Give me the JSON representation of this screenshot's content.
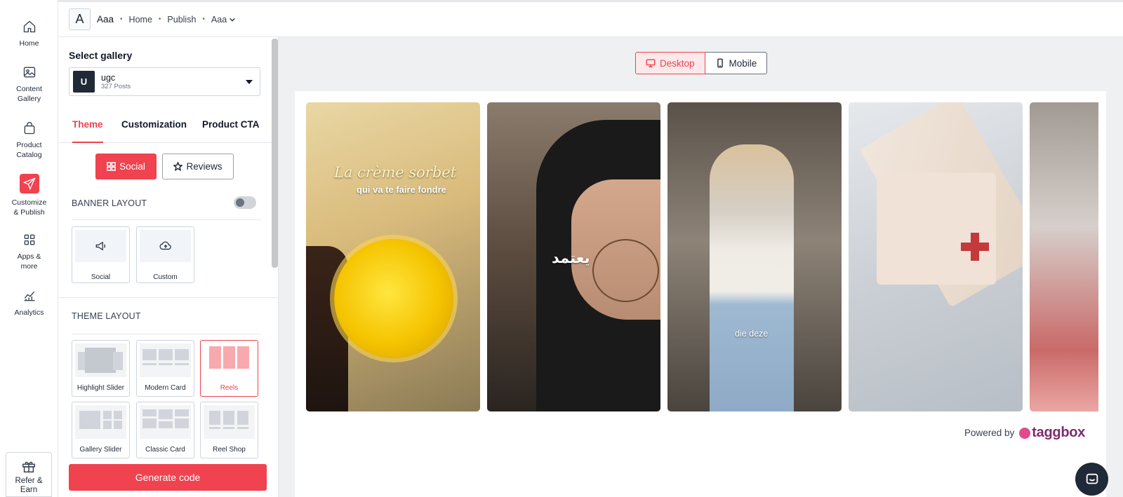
{
  "nav": {
    "items": [
      {
        "label_1": "Home",
        "label_2": "",
        "icon": "home-icon"
      },
      {
        "label_1": "Content",
        "label_2": "Gallery",
        "icon": "image-icon"
      },
      {
        "label_1": "Product",
        "label_2": "Catalog",
        "icon": "shopping-bag-icon"
      },
      {
        "label_1": "Customize",
        "label_2": "& Publish",
        "icon": "paper-plane-icon"
      },
      {
        "label_1": "Apps &",
        "label_2": "more",
        "icon": "grid-icon"
      },
      {
        "label_1": "Analytics",
        "label_2": "",
        "icon": "chart-icon"
      }
    ],
    "refer": {
      "label_1": "Refer &",
      "label_2": "Earn",
      "icon": "gift-icon"
    }
  },
  "header": {
    "logo_letter": "A",
    "workspace": "Aaa",
    "sep": "•",
    "crumbs": [
      "Home",
      "Publish"
    ],
    "dropdown": "Aaa"
  },
  "panel": {
    "title": "Select gallery",
    "gallery": {
      "avatar": "U",
      "name": "ugc",
      "count": "327 Posts"
    },
    "tabs": [
      "Theme",
      "Customization",
      "Product CTA"
    ],
    "segment": {
      "social": "Social",
      "reviews": "Reviews"
    },
    "banner_layout": {
      "label": "BANNER LAYOUT",
      "options": [
        {
          "label": "Social",
          "icon": "megaphone-icon"
        },
        {
          "label": "Custom",
          "icon": "cloud-upload-icon"
        }
      ]
    },
    "theme_layout": {
      "label": "THEME LAYOUT",
      "options": [
        "Highlight Slider",
        "Modern Card",
        "Reels",
        "Gallery Slider",
        "Classic Card",
        "Reel Shop"
      ],
      "selected": "Reels"
    },
    "generate_button": "Generate code"
  },
  "preview": {
    "devices": {
      "desktop": "Desktop",
      "mobile": "Mobile"
    },
    "reels": [
      {
        "caption_1": "La crème sorbet",
        "caption_2": "qui va te faire fondre"
      },
      {
        "caption_1": "يعتمد"
      },
      {
        "caption_1": "die deze"
      },
      {},
      {}
    ],
    "powered_by": "Powered by",
    "brand": "taggbox"
  },
  "colors": {
    "accent": "#f0424f",
    "dark": "#1f2937"
  }
}
